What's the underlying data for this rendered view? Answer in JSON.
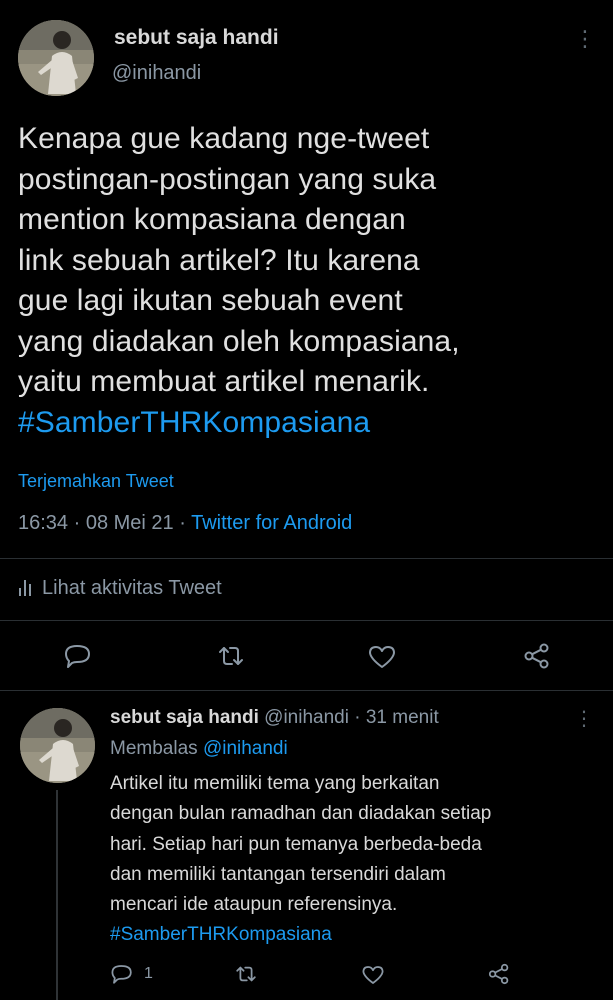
{
  "main_tweet": {
    "author_name": "sebut saja handi",
    "author_handle": "@inihandi",
    "text_lines": [
      "Kenapa gue kadang nge-tweet",
      "postingan-postingan yang suka",
      "mention kompasiana dengan",
      "link sebuah artikel? Itu karena",
      "gue lagi ikutan sebuah event",
      "yang diadakan oleh kompasiana,",
      "yaitu membuat artikel menarik."
    ],
    "hashtag": "#SamberTHRKompasiana",
    "translate_label": "Terjemahkan Tweet",
    "time": "16:34",
    "date": "08 Mei 21",
    "source": "Twitter for Android",
    "activity_label": "Lihat aktivitas Tweet"
  },
  "reply_tweet": {
    "author_name": "sebut saja handi",
    "author_handle": "@inihandi",
    "age": "31 menit",
    "replying_prefix": "Membalas",
    "replying_to": "@inihandi",
    "text_lines": [
      "Artikel itu memiliki tema yang berkaitan",
      "dengan bulan ramadhan dan diadakan setiap",
      "hari. Setiap hari pun temanya berbeda-beda",
      "dan memiliki tantangan tersendiri dalam",
      "mencari ide ataupun referensinya."
    ],
    "hashtag": "#SamberTHRKompasiana",
    "reply_count": "1"
  },
  "icons": {
    "more": "more-vertical-icon",
    "analytics": "bar-chart-icon",
    "reply": "reply-bubble-icon",
    "retweet": "retweet-icon",
    "like": "heart-icon",
    "share": "share-icon"
  },
  "colors": {
    "background": "#000000",
    "text": "#d9d9d9",
    "secondary": "#8b98a5",
    "accent": "#1d9bf0",
    "divider": "#2a2f33"
  }
}
